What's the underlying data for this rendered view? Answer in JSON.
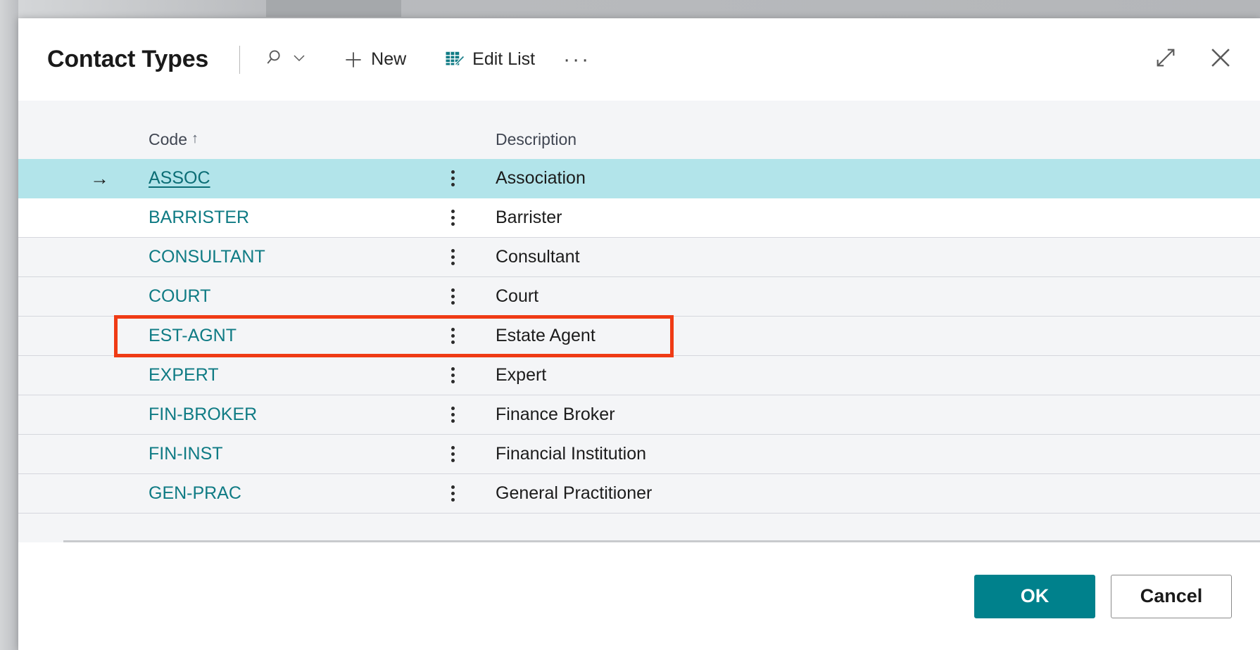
{
  "dialog": {
    "title": "Contact Types",
    "header_actions": [
      {
        "id": "search",
        "label": "",
        "icon": "search-icon"
      },
      {
        "id": "new",
        "label": "New",
        "icon": "plus-icon"
      },
      {
        "id": "edit-list",
        "label": "Edit List",
        "icon": "edit-list-icon"
      },
      {
        "id": "more",
        "label": "···",
        "icon": "ellipsis-icon"
      }
    ],
    "window_controls": [
      {
        "id": "expand",
        "icon": "expand-diagonal-icon"
      },
      {
        "id": "close",
        "icon": "close-icon"
      }
    ]
  },
  "grid": {
    "columns": [
      {
        "key": "code",
        "label": "Code",
        "sort": "↑",
        "sorted": true
      },
      {
        "key": "description",
        "label": "Description",
        "sort": "",
        "sorted": false
      }
    ],
    "row_menu_icon": "vertical-ellipsis-icon",
    "selected_indicator": "→",
    "rows": [
      {
        "code": "ASSOC",
        "description": "Association",
        "selected": true,
        "highlighted": false
      },
      {
        "code": "BARRISTER",
        "description": "Barrister",
        "selected": false,
        "highlighted": true
      },
      {
        "code": "CONSULTANT",
        "description": "Consultant",
        "selected": false,
        "highlighted": false
      },
      {
        "code": "COURT",
        "description": "Court",
        "selected": false,
        "highlighted": false
      },
      {
        "code": "EST-AGNT",
        "description": "Estate Agent",
        "selected": false,
        "highlighted": false
      },
      {
        "code": "EXPERT",
        "description": "Expert",
        "selected": false,
        "highlighted": false
      },
      {
        "code": "FIN-BROKER",
        "description": "Finance Broker",
        "selected": false,
        "highlighted": false
      },
      {
        "code": "FIN-INST",
        "description": "Financial Institution",
        "selected": false,
        "highlighted": false
      },
      {
        "code": "GEN-PRAC",
        "description": "General Practitioner",
        "selected": false,
        "highlighted": false
      }
    ]
  },
  "footer": {
    "ok_label": "OK",
    "cancel_label": "Cancel"
  },
  "colors": {
    "accent_teal": "#00818c",
    "link_teal": "#0f7b84",
    "row_selected": "#b2e4ea",
    "row_background": "#f4f5f7",
    "annotation_red": "#ef3b15",
    "row_divider": "#d5d7dd"
  }
}
